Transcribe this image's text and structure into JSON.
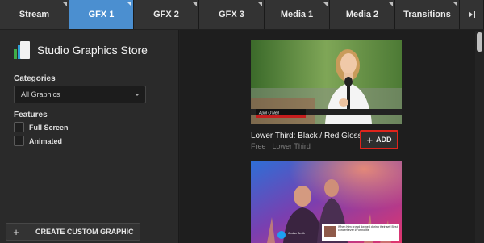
{
  "tabs": [
    {
      "label": "Stream"
    },
    {
      "label": "GFX 1"
    },
    {
      "label": "GFX 2"
    },
    {
      "label": "GFX 3"
    },
    {
      "label": "Media 1"
    },
    {
      "label": "Media 2"
    },
    {
      "label": "Transitions"
    }
  ],
  "active_tab": "GFX 1",
  "sidebar": {
    "store_title": "Studio Graphics Store",
    "categories_label": "Categories",
    "categories_value": "All Graphics",
    "features_label": "Features",
    "features": [
      {
        "label": "Full Screen",
        "checked": false
      },
      {
        "label": "Animated",
        "checked": false
      }
    ],
    "create_button": "CREATE CUSTOM GRAPHIC"
  },
  "cards": [
    {
      "lower_third_name": "April O'Neil",
      "title": "Lower Third: Black / Red Gloss",
      "subtitle": "Free · Lower Third",
      "add_label": "ADD"
    },
    {
      "tweet_text": "When Kim crowd dwmed during their set! Best concert ever #Fortnotitie",
      "tweet_user": "Jordan Smith"
    }
  ],
  "colors": {
    "active_tab": "#4b8fd0",
    "add_highlight": "#e0241b"
  }
}
